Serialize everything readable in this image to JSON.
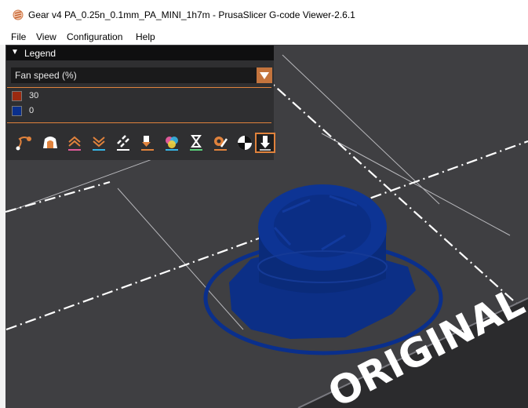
{
  "window": {
    "title": "Gear v4 PA_0.25n_0.1mm_PA_MINI_1h7m - PrusaSlicer G-code Viewer-2.6.1"
  },
  "menu": [
    {
      "label": "File"
    },
    {
      "label": "View"
    },
    {
      "label": "Configuration"
    },
    {
      "label": "Help"
    }
  ],
  "legend": {
    "title": "Legend",
    "view_type": "Fan speed (%)",
    "items": [
      {
        "label": "30",
        "color": "#9b2a10"
      },
      {
        "label": "0",
        "color": "#0a2f8c"
      }
    ],
    "toolbar": [
      {
        "name": "travel-icon"
      },
      {
        "name": "wipe-icon"
      },
      {
        "name": "retractions-icon"
      },
      {
        "name": "deretractions-icon"
      },
      {
        "name": "seams-icon"
      },
      {
        "name": "tool-changes-icon"
      },
      {
        "name": "color-changes-icon"
      },
      {
        "name": "pause-prints-icon"
      },
      {
        "name": "custom-gcodes-icon"
      },
      {
        "name": "center-of-gravity-icon"
      },
      {
        "name": "tool-marker-icon",
        "active": true
      }
    ]
  },
  "bed": {
    "label": "ORIGINAL P"
  },
  "colors": {
    "accent": "#e0823c",
    "model": "#0a2f8c",
    "bed": "#3f3f42"
  }
}
